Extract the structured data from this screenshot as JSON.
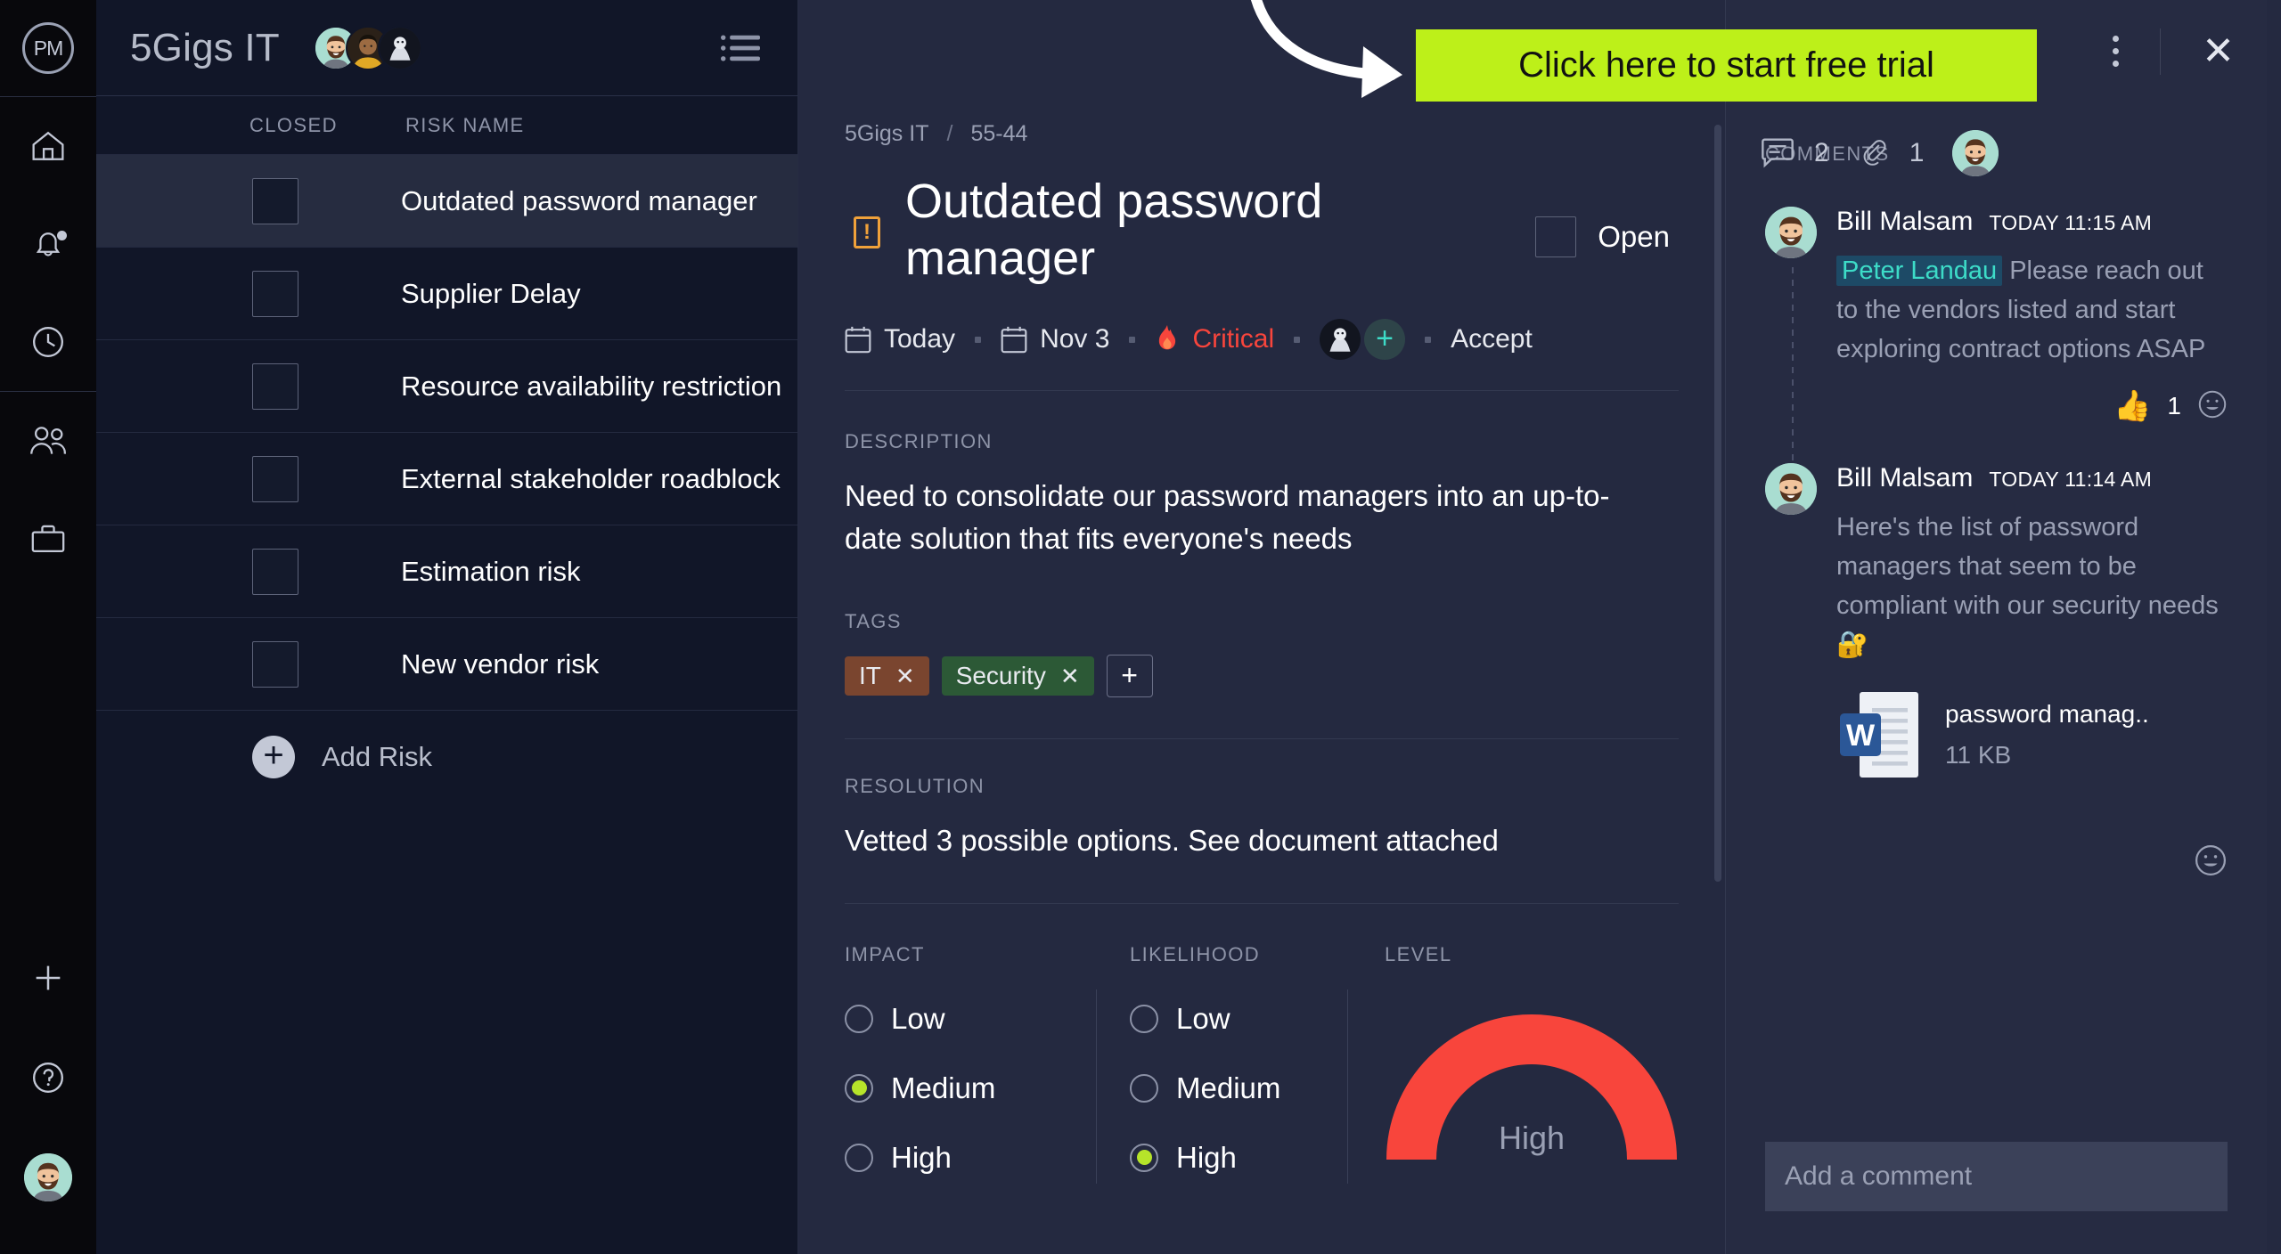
{
  "rail": {
    "logo": "PM",
    "items": [
      {
        "name": "home-icon",
        "label": "Home"
      },
      {
        "name": "bell-icon",
        "label": "Notifications"
      },
      {
        "name": "clock-icon",
        "label": "Timesheets"
      },
      {
        "name": "people-icon",
        "label": "Team"
      },
      {
        "name": "briefcase-icon",
        "label": "Projects"
      }
    ],
    "bottom": [
      {
        "name": "plus-icon",
        "label": "Add"
      },
      {
        "name": "help-icon",
        "label": "Help"
      },
      {
        "name": "user-avatar",
        "label": "Account"
      }
    ]
  },
  "list": {
    "project_title": "5Gigs IT",
    "menu_icon": "list-view-icon",
    "columns": {
      "closed": "CLOSED",
      "risk_name": "RISK NAME"
    },
    "rows": [
      {
        "name": "Outdated password manager",
        "closed": false,
        "selected": true
      },
      {
        "name": "Supplier Delay",
        "closed": false,
        "selected": false
      },
      {
        "name": "Resource availability restriction",
        "closed": false,
        "selected": false
      },
      {
        "name": "External stakeholder roadblock",
        "closed": false,
        "selected": false
      },
      {
        "name": "Estimation risk",
        "closed": false,
        "selected": false
      },
      {
        "name": "New vendor risk",
        "closed": false,
        "selected": false
      }
    ],
    "add_risk_label": "Add Risk"
  },
  "detail": {
    "breadcrumb_project": "5Gigs IT",
    "breadcrumb_sep": "/",
    "breadcrumb_id": "55-44",
    "comment_count": "2",
    "attachment_count": "1",
    "title": "Outdated password manager",
    "status_label": "Open",
    "status_checked": false,
    "warning_glyph": "!",
    "meta": {
      "start_date": "Today",
      "due_date": "Nov 3",
      "priority": "Critical",
      "priority_color": "#f8453c",
      "priority_icon": "fire-icon",
      "add_assignee": "+",
      "action": "Accept"
    },
    "description_label": "DESCRIPTION",
    "description": "Need to consolidate our password managers into an up-to-date solution that fits everyone's needs",
    "tags_label": "TAGS",
    "tags": [
      {
        "label": "IT",
        "color": "#7a452f",
        "remove": "✕"
      },
      {
        "label": "Security",
        "color": "#2c5936",
        "remove": "✕"
      }
    ],
    "tag_add": "+",
    "resolution_label": "RESOLUTION",
    "resolution": "Vetted 3 possible options. See document attached",
    "impact": {
      "label": "IMPACT",
      "options": [
        "Low",
        "Medium",
        "High"
      ],
      "selected": "Medium"
    },
    "likelihood": {
      "label": "LIKELIHOOD",
      "options": [
        "Low",
        "Medium",
        "High"
      ],
      "selected": "High"
    },
    "level": {
      "label": "LEVEL",
      "value": "High",
      "color": "#f8453c"
    }
  },
  "comments": {
    "title": "COMMENTS",
    "items": [
      {
        "author": "Bill Malsam",
        "time": "TODAY 11:15 AM",
        "mention": "Peter Landau",
        "text": "Please reach out to the vendors listed and start exploring contract options ASAP",
        "reaction_emoji": "👍",
        "reaction_count": "1",
        "has_attachment": false
      },
      {
        "author": "Bill Malsam",
        "time": "TODAY 11:14 AM",
        "mention": "",
        "text": "Here's the list of password managers that seem to be compliant with our security needs 🔐",
        "reaction_emoji": "",
        "reaction_count": "",
        "has_attachment": true,
        "attachment_name": "password manag..",
        "attachment_size": "11 KB",
        "attachment_type": "word-document"
      }
    ],
    "input_placeholder": "Add a comment"
  },
  "overlay": {
    "cta_label": "Click here to start free trial",
    "cta_color": "#bdf019",
    "kebab_icon": "more-vertical-icon",
    "close_icon": "close-icon",
    "arrow_icon": "curved-arrow-icon"
  }
}
